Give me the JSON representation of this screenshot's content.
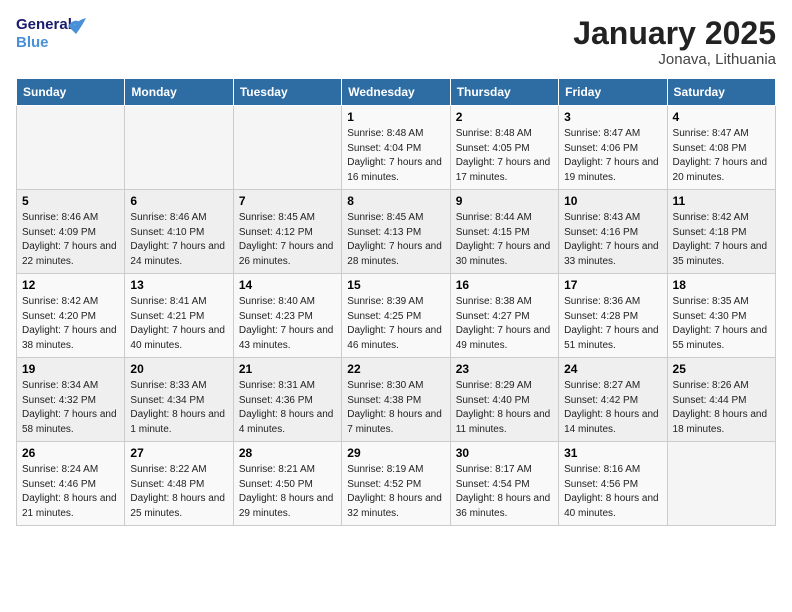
{
  "header": {
    "logo_line1": "General",
    "logo_line2": "Blue",
    "title": "January 2025",
    "subtitle": "Jonava, Lithuania"
  },
  "calendar": {
    "days_of_week": [
      "Sunday",
      "Monday",
      "Tuesday",
      "Wednesday",
      "Thursday",
      "Friday",
      "Saturday"
    ],
    "weeks": [
      [
        {
          "day": "",
          "content": ""
        },
        {
          "day": "",
          "content": ""
        },
        {
          "day": "",
          "content": ""
        },
        {
          "day": "1",
          "content": "Sunrise: 8:48 AM\nSunset: 4:04 PM\nDaylight: 7 hours and 16 minutes."
        },
        {
          "day": "2",
          "content": "Sunrise: 8:48 AM\nSunset: 4:05 PM\nDaylight: 7 hours and 17 minutes."
        },
        {
          "day": "3",
          "content": "Sunrise: 8:47 AM\nSunset: 4:06 PM\nDaylight: 7 hours and 19 minutes."
        },
        {
          "day": "4",
          "content": "Sunrise: 8:47 AM\nSunset: 4:08 PM\nDaylight: 7 hours and 20 minutes."
        }
      ],
      [
        {
          "day": "5",
          "content": "Sunrise: 8:46 AM\nSunset: 4:09 PM\nDaylight: 7 hours and 22 minutes."
        },
        {
          "day": "6",
          "content": "Sunrise: 8:46 AM\nSunset: 4:10 PM\nDaylight: 7 hours and 24 minutes."
        },
        {
          "day": "7",
          "content": "Sunrise: 8:45 AM\nSunset: 4:12 PM\nDaylight: 7 hours and 26 minutes."
        },
        {
          "day": "8",
          "content": "Sunrise: 8:45 AM\nSunset: 4:13 PM\nDaylight: 7 hours and 28 minutes."
        },
        {
          "day": "9",
          "content": "Sunrise: 8:44 AM\nSunset: 4:15 PM\nDaylight: 7 hours and 30 minutes."
        },
        {
          "day": "10",
          "content": "Sunrise: 8:43 AM\nSunset: 4:16 PM\nDaylight: 7 hours and 33 minutes."
        },
        {
          "day": "11",
          "content": "Sunrise: 8:42 AM\nSunset: 4:18 PM\nDaylight: 7 hours and 35 minutes."
        }
      ],
      [
        {
          "day": "12",
          "content": "Sunrise: 8:42 AM\nSunset: 4:20 PM\nDaylight: 7 hours and 38 minutes."
        },
        {
          "day": "13",
          "content": "Sunrise: 8:41 AM\nSunset: 4:21 PM\nDaylight: 7 hours and 40 minutes."
        },
        {
          "day": "14",
          "content": "Sunrise: 8:40 AM\nSunset: 4:23 PM\nDaylight: 7 hours and 43 minutes."
        },
        {
          "day": "15",
          "content": "Sunrise: 8:39 AM\nSunset: 4:25 PM\nDaylight: 7 hours and 46 minutes."
        },
        {
          "day": "16",
          "content": "Sunrise: 8:38 AM\nSunset: 4:27 PM\nDaylight: 7 hours and 49 minutes."
        },
        {
          "day": "17",
          "content": "Sunrise: 8:36 AM\nSunset: 4:28 PM\nDaylight: 7 hours and 51 minutes."
        },
        {
          "day": "18",
          "content": "Sunrise: 8:35 AM\nSunset: 4:30 PM\nDaylight: 7 hours and 55 minutes."
        }
      ],
      [
        {
          "day": "19",
          "content": "Sunrise: 8:34 AM\nSunset: 4:32 PM\nDaylight: 7 hours and 58 minutes."
        },
        {
          "day": "20",
          "content": "Sunrise: 8:33 AM\nSunset: 4:34 PM\nDaylight: 8 hours and 1 minute."
        },
        {
          "day": "21",
          "content": "Sunrise: 8:31 AM\nSunset: 4:36 PM\nDaylight: 8 hours and 4 minutes."
        },
        {
          "day": "22",
          "content": "Sunrise: 8:30 AM\nSunset: 4:38 PM\nDaylight: 8 hours and 7 minutes."
        },
        {
          "day": "23",
          "content": "Sunrise: 8:29 AM\nSunset: 4:40 PM\nDaylight: 8 hours and 11 minutes."
        },
        {
          "day": "24",
          "content": "Sunrise: 8:27 AM\nSunset: 4:42 PM\nDaylight: 8 hours and 14 minutes."
        },
        {
          "day": "25",
          "content": "Sunrise: 8:26 AM\nSunset: 4:44 PM\nDaylight: 8 hours and 18 minutes."
        }
      ],
      [
        {
          "day": "26",
          "content": "Sunrise: 8:24 AM\nSunset: 4:46 PM\nDaylight: 8 hours and 21 minutes."
        },
        {
          "day": "27",
          "content": "Sunrise: 8:22 AM\nSunset: 4:48 PM\nDaylight: 8 hours and 25 minutes."
        },
        {
          "day": "28",
          "content": "Sunrise: 8:21 AM\nSunset: 4:50 PM\nDaylight: 8 hours and 29 minutes."
        },
        {
          "day": "29",
          "content": "Sunrise: 8:19 AM\nSunset: 4:52 PM\nDaylight: 8 hours and 32 minutes."
        },
        {
          "day": "30",
          "content": "Sunrise: 8:17 AM\nSunset: 4:54 PM\nDaylight: 8 hours and 36 minutes."
        },
        {
          "day": "31",
          "content": "Sunrise: 8:16 AM\nSunset: 4:56 PM\nDaylight: 8 hours and 40 minutes."
        },
        {
          "day": "",
          "content": ""
        }
      ]
    ]
  }
}
